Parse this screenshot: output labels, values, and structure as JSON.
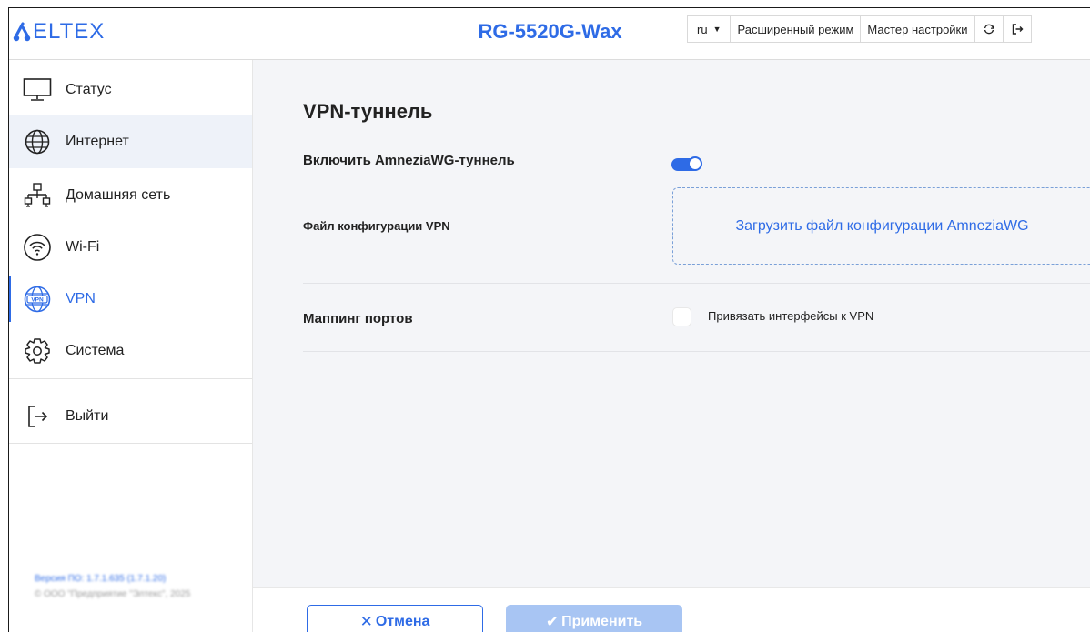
{
  "header": {
    "logo_text": "ELTEX",
    "device_title": "RG-5520G-Wax",
    "language": "ru",
    "advanced_mode": "Расширенный режим",
    "setup_wizard": "Мастер настройки"
  },
  "sidebar": {
    "items": [
      {
        "label": "Статус",
        "icon": "monitor-icon"
      },
      {
        "label": "Интернет",
        "icon": "globe-icon"
      },
      {
        "label": "Домашняя сеть",
        "icon": "network-icon"
      },
      {
        "label": "Wi-Fi",
        "icon": "wifi-icon"
      },
      {
        "label": "VPN",
        "icon": "vpn-globe-icon"
      },
      {
        "label": "Система",
        "icon": "gear-icon"
      }
    ],
    "logout_label": "Выйти",
    "footer_version": "Версия ПО: 1.7.1.635 (1.7.1.20)",
    "footer_copyright": "© ООО \"Предприятие \"Элтекс\", 2025"
  },
  "main": {
    "title": "VPN-туннель",
    "enable_label": "Включить AmneziaWG-туннель",
    "enable_on": true,
    "config_label": "Файл конфигурации VPN",
    "upload_label": "Загрузить файл конфигурации AmneziaWG",
    "port_mapping_label": "Маппинг портов",
    "bind_checkbox_label": "Привязать интерфейсы к VPN",
    "bind_checked": false
  },
  "actions": {
    "cancel_label": "Отмена",
    "apply_label": "Применить"
  },
  "colors": {
    "accent": "#2e6be6",
    "apply_disabled": "#a8c5f3",
    "main_bg": "#f4f5f8",
    "active_nav_bg": "#eef2f9"
  }
}
